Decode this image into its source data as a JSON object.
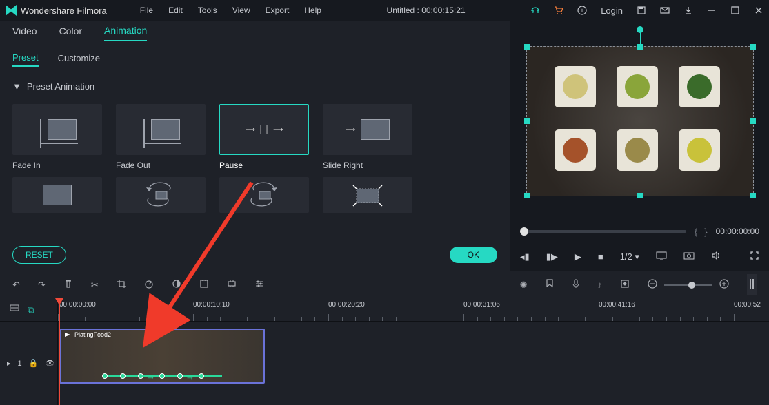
{
  "app": {
    "name": "Wondershare Filmora"
  },
  "menu": {
    "file": "File",
    "edit": "Edit",
    "tools": "Tools",
    "view": "View",
    "export": "Export",
    "help": "Help"
  },
  "title": "Untitled : 00:00:15:21",
  "login": "Login",
  "media_tabs": {
    "video": "Video",
    "color": "Color",
    "animation": "Animation"
  },
  "sub_tabs": {
    "preset": "Preset",
    "customize": "Customize"
  },
  "section_header": "Preset Animation",
  "presets": {
    "fade_in": "Fade In",
    "fade_out": "Fade Out",
    "pause": "Pause",
    "slide_right": "Slide Right"
  },
  "buttons": {
    "reset": "RESET",
    "ok": "OK"
  },
  "preview": {
    "time_display": "00:00:00:00",
    "brace_open": "{",
    "brace_close": "}",
    "playback_ratio": "1/2"
  },
  "timeline": {
    "ruler": [
      "00:00:00:00",
      "00:00:10:10",
      "00:00:20:20",
      "00:00:31:06",
      "00:00:41:16",
      "00:00:52"
    ],
    "track_label": "1",
    "clip_name": "PlatingFood2"
  }
}
